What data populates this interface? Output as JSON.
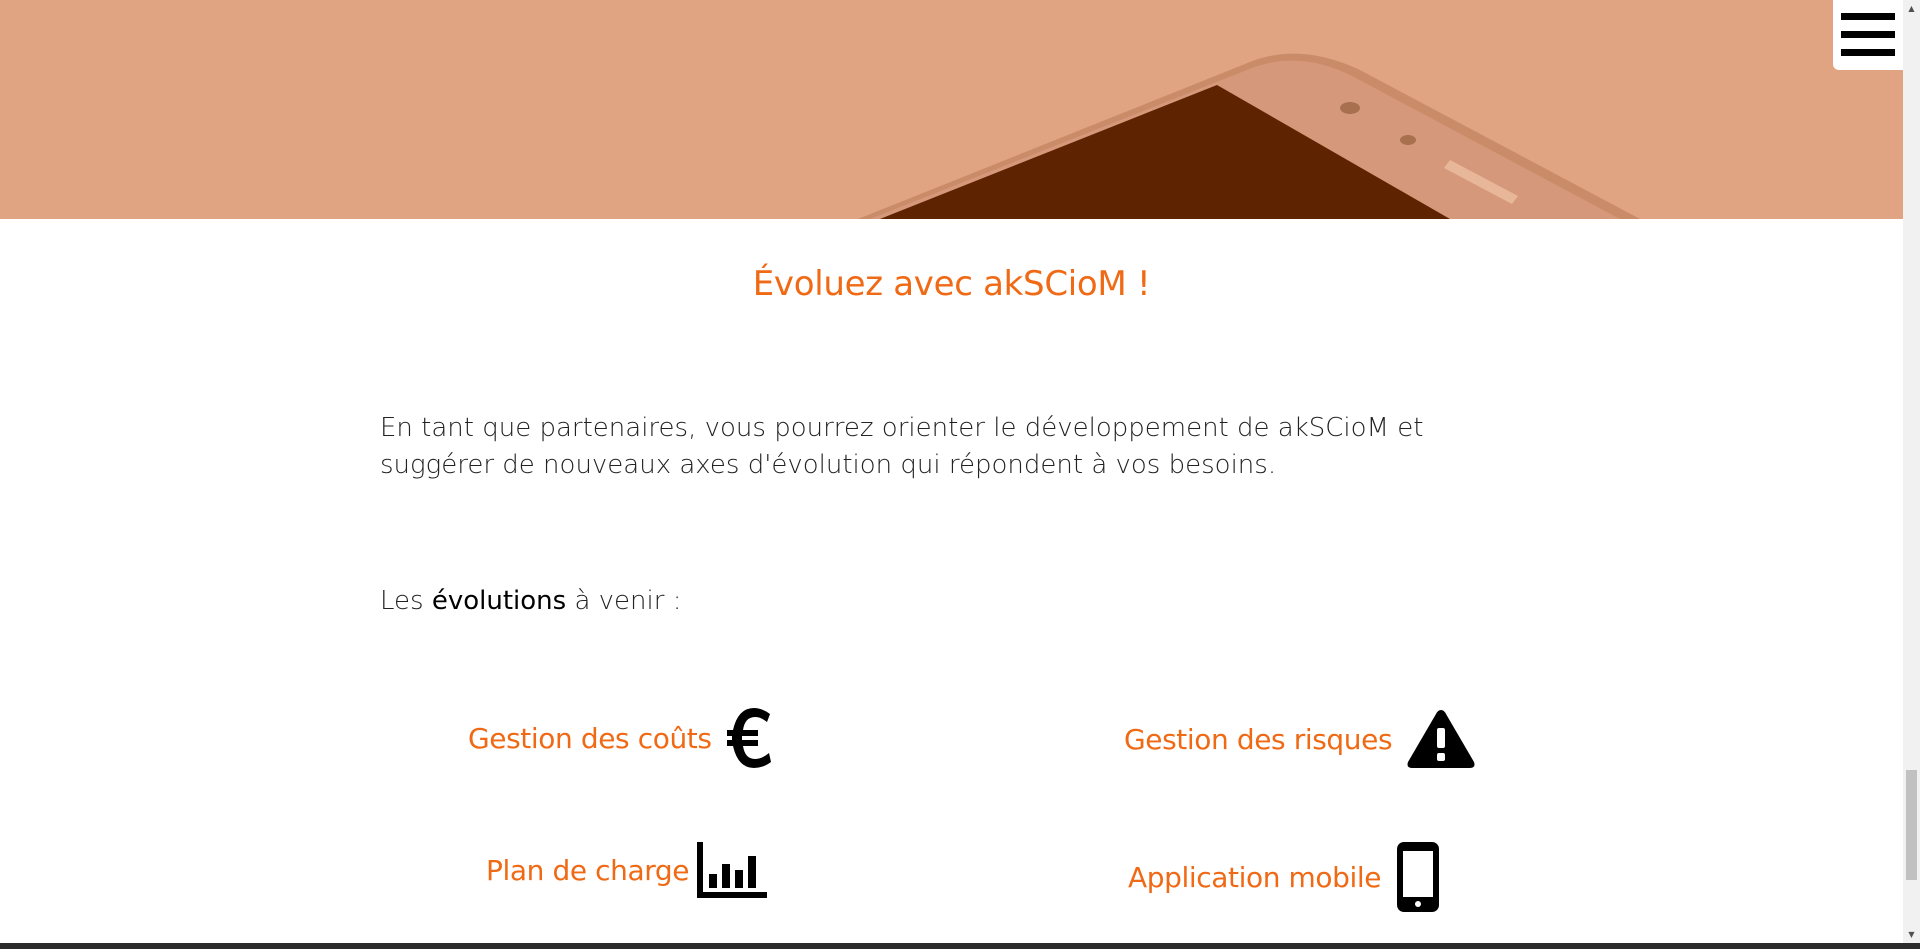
{
  "menu": {
    "icon": "hamburger-menu-icon"
  },
  "section": {
    "title": "Évoluez avec akSCioM !",
    "intro": "En tant que partenaires, vous pourrez orienter le développement de akSCioM et suggérer de nouveaux axes d'évolution qui répondent à vos besoins.",
    "upcoming_prefix": "Les ",
    "upcoming_strong": "évolutions",
    "upcoming_suffix": " à venir :"
  },
  "features": [
    {
      "label": "Gestion des coûts",
      "icon": "euro-icon"
    },
    {
      "label": "Gestion des risques",
      "icon": "warning-icon"
    },
    {
      "label": "Plan de charge",
      "icon": "bar-chart-icon"
    },
    {
      "label": "Application mobile",
      "icon": "mobile-phone-icon"
    }
  ],
  "colors": {
    "accent": "#f06a16",
    "hero_background": "#e0a482",
    "hero_dark": "#5e2300",
    "text": "#222222"
  }
}
